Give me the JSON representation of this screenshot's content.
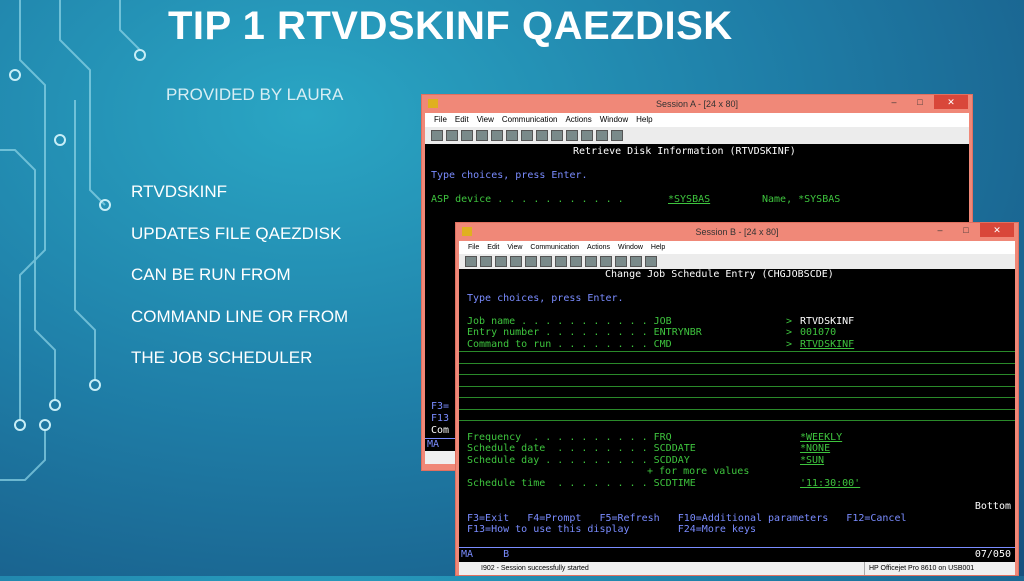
{
  "slide": {
    "title": "TIP 1 RTVDSKINF  QAEZDISK",
    "subtitle": "PROVIDED BY LAURA",
    "bullets": [
      "RTVDSKINF",
      "UPDATES FILE QAEZDISK",
      "CAN BE RUN FROM",
      "COMMAND LINE OR FROM",
      "THE JOB SCHEDULER"
    ]
  },
  "menu": [
    "File",
    "Edit",
    "View",
    "Communication",
    "Actions",
    "Window",
    "Help"
  ],
  "session_a": {
    "title": "Session A - [24 x 80]",
    "header": "Retrieve Disk Information (RTVDSKINF)",
    "prompt": "Type choices, press Enter.",
    "asp_label": "ASP device . . . . . . . . . . .",
    "asp_value": "*SYSBAS",
    "asp_hint": "Name, *SYSBAS",
    "f3": "F3=",
    "f13": "F13",
    "com": "Com",
    "ma": "MA"
  },
  "session_b": {
    "title": "Session B - [24 x 80]",
    "header": "Change Job Schedule Entry (CHGJOBSCDE)",
    "prompt": "Type choices, press Enter.",
    "fields": [
      {
        "label": "Job name . . . . . . . . . . . JOB",
        "marker": ">",
        "value": "RTVDSKINF"
      },
      {
        "label": "Entry number . . . . . . . . . ENTRYNBR",
        "marker": ">",
        "value": "001070"
      },
      {
        "label": "Command to run . . . . . . . . CMD",
        "marker": ">",
        "value": "RTVDSKINF"
      },
      {
        "label": "Frequency  . . . . . . . . . . FRQ",
        "value": "*WEEKLY"
      },
      {
        "label": "Schedule date  . . . . . . . . SCDDATE",
        "value": "*NONE"
      },
      {
        "label": "Schedule day . . . . . . . . . SCDDAY",
        "value": "*SUN"
      },
      {
        "label": "Schedule time  . . . . . . . . SCDTIME",
        "value": "'11:30:00'"
      }
    ],
    "more_values": "+ for more values",
    "bottom": "Bottom",
    "fkeys1": "F3=Exit   F4=Prompt   F5=Refresh   F10=Additional parameters   F12=Cancel",
    "fkeys2": "F13=How to use this display        F24=More keys",
    "oia_left": "MA     B",
    "oia_right": "07/050",
    "status_msg": "I902 - Session successfully started",
    "printer": "HP Officejet Pro 8610 on USB001"
  },
  "colors": {
    "title_bar": "#f08878",
    "terminal_bg": "#000000",
    "field_green": "#3ec43e",
    "prompt_blue": "#7a8cff"
  }
}
